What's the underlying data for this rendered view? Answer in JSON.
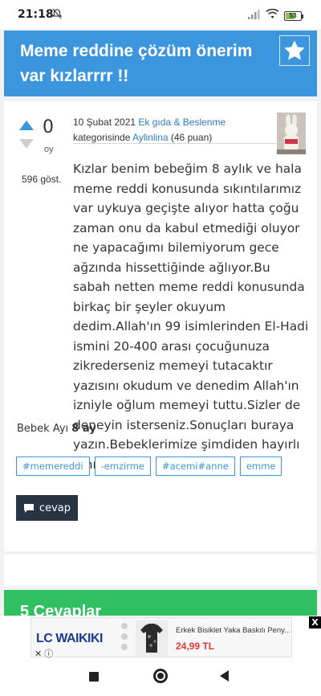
{
  "status_bar": {
    "time": "21:18",
    "battery": "53",
    "battery_level": 0.53,
    "icons": [
      "mute-icon",
      "signal-icon",
      "wifi-icon",
      "battery-icon"
    ]
  },
  "question": {
    "title": "Meme reddine çözüm önerim var kızlarrrr !!",
    "votes": "0",
    "votes_unit": "oy",
    "views": "596 göst.",
    "date": "10 Şubat 2021",
    "category": "Ek gıda & Beslenme",
    "category_suffix": "kategorisinde",
    "author": "Aylinlina",
    "points": "(46 puan)",
    "body": "Kızlar benim bebeğim 8 aylık ve hala meme reddi konusunda sıkıntılarımız var uykuya geçişte alıyor hatta çoğu zaman onu da kabul etmediği oluyor ne yapacağımı bilemiyorum gece ağzında hissettiğinde ağlıyor.Bu sabah netten meme reddi konusunda birkaç bir şeyler okuyum dedim.Allah'ın 99 isimlerinden El-Hadi ismini 20-400 arası çocuğunuza zikrederseniz memeyi tutacaktır yazısını okudum ve denedim Allah'ın izniyle oğlum memeyi tuttu.Sizler de deneyin isterseniz.Sonuçları buraya yazın.Bebeklerimize şimdiden hayırlı emmeler ;)",
    "baby_age_label": "Bebek Ayı",
    "baby_age_value": "8 ay",
    "tags": [
      "#memereddi",
      "-emzirme",
      "#acemi#anne",
      "emme"
    ],
    "reply_label": "cevap"
  },
  "answers": {
    "header": "5 Cevaplar"
  },
  "ad": {
    "brand": "LC WAIKIKI",
    "product_title": "Erkek Bisiklet Yaka Baskılı Peny...",
    "price": "24,99 TL",
    "close_label": "X"
  },
  "colors": {
    "primary": "#3c96de",
    "answers_green": "#31c061",
    "dark_button": "#273444",
    "link": "#2e7bbf",
    "price_red": "#e53935"
  }
}
